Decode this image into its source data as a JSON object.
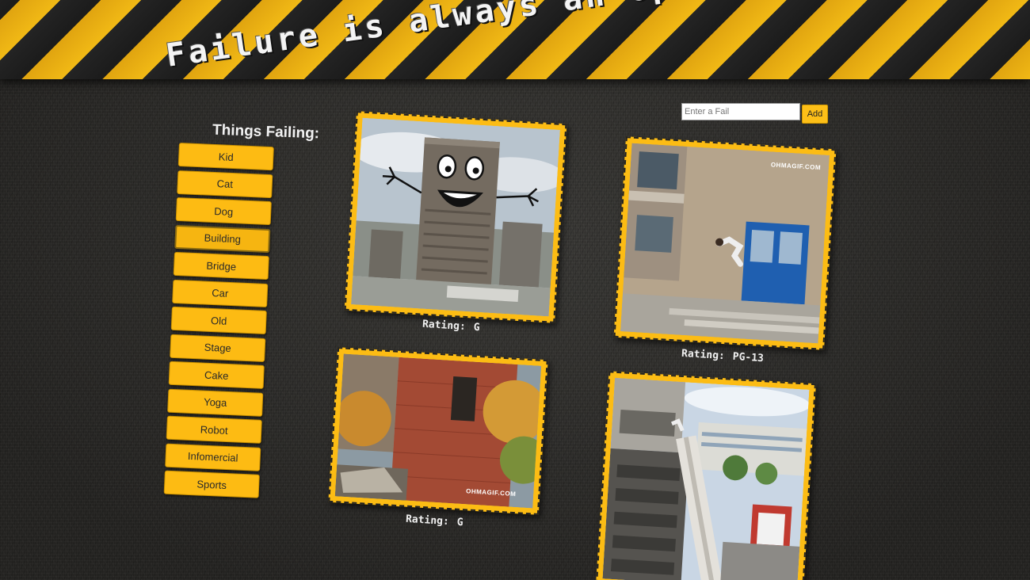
{
  "header": {
    "title": "Failure is always an option"
  },
  "form": {
    "input_placeholder": "Enter a Fail",
    "add_label": "Add"
  },
  "sidebar": {
    "title": "Things Failing:",
    "items": [
      "Kid",
      "Cat",
      "Dog",
      "Building",
      "Bridge",
      "Car",
      "Old",
      "Stage",
      "Cake",
      "Yoga",
      "Robot",
      "Infomercial",
      "Sports"
    ],
    "active_item": "Building"
  },
  "gifs": [
    {
      "rating_label": "Rating:",
      "rating": "G",
      "watermark": ""
    },
    {
      "rating_label": "Rating:",
      "rating": "PG-13",
      "watermark": "OHMAGIF.COM"
    },
    {
      "rating_label": "Rating:",
      "rating": "G",
      "watermark": "OHMAGIF.COM"
    },
    {
      "rating_label": "",
      "rating": "",
      "watermark": ""
    }
  ],
  "colors": {
    "accent": "#fdbb13",
    "stripe_dark": "#1b1b1b",
    "background": "#2b2a28"
  }
}
